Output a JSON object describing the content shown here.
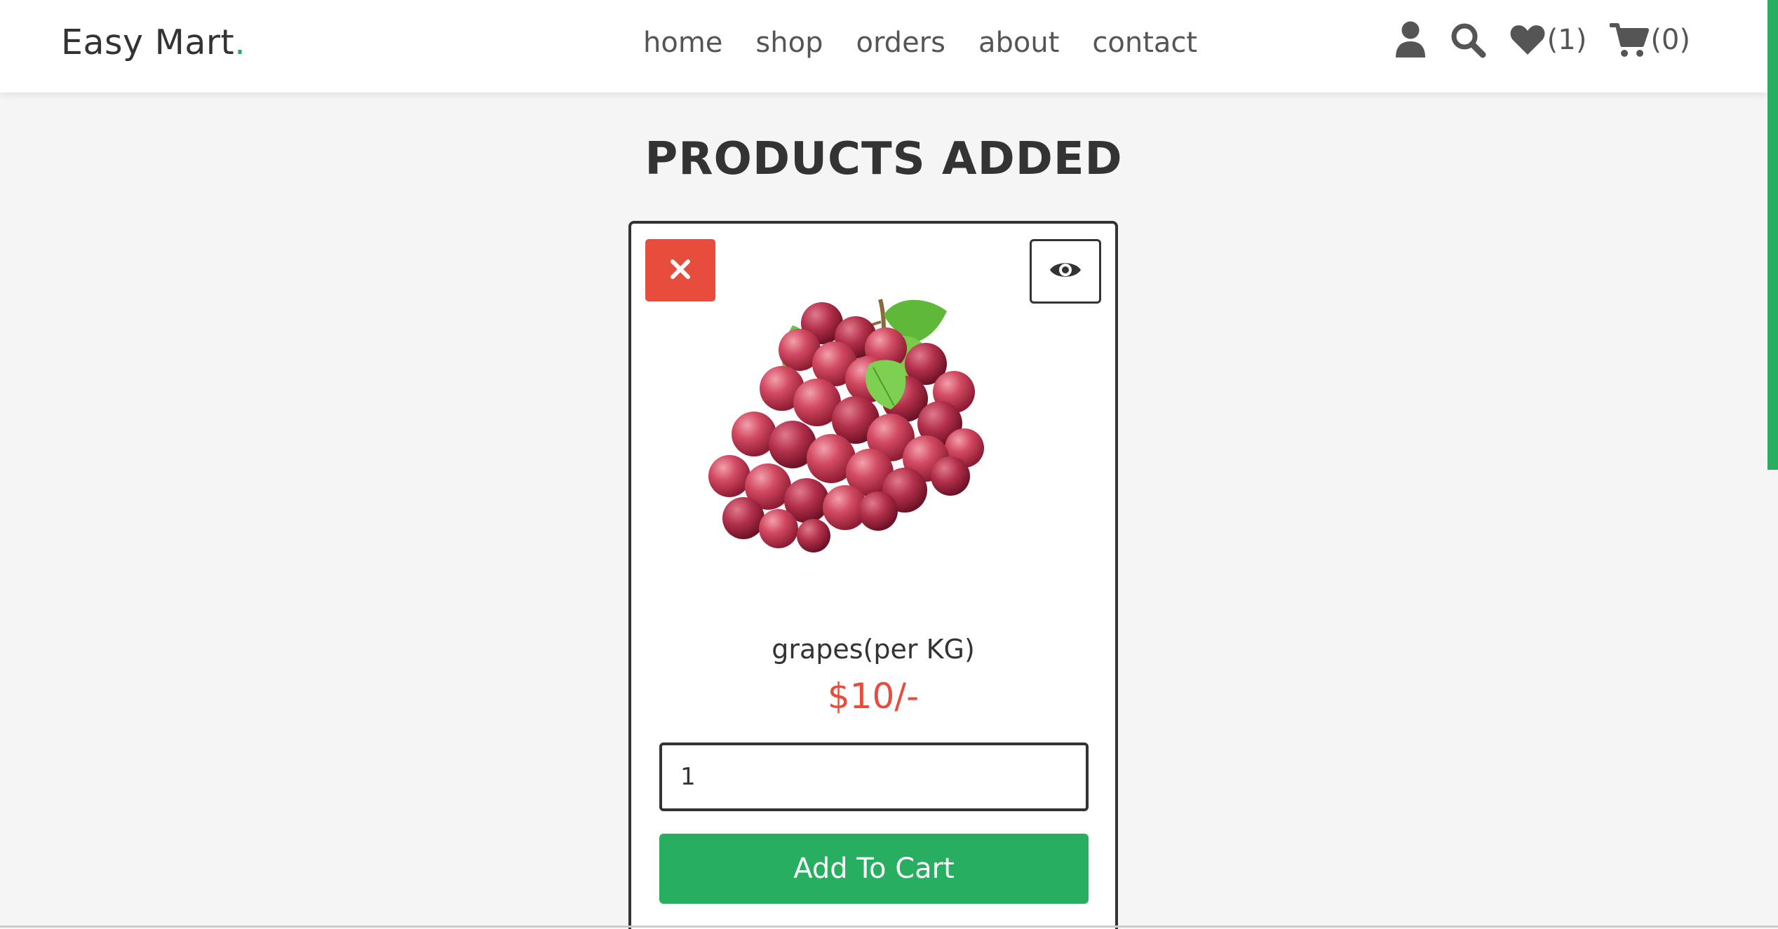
{
  "header": {
    "logo_text": "Easy Mart",
    "logo_dot": ".",
    "nav": [
      "home",
      "shop",
      "orders",
      "about",
      "contact"
    ],
    "wishlist_count": "(1)",
    "cart_count": "(0)",
    "icons": [
      "user-icon",
      "search-icon",
      "heart-icon",
      "cart-icon"
    ]
  },
  "main": {
    "title": "PRODUCTS ADDED",
    "product": {
      "name": "grapes(per KG)",
      "price": "$10/-",
      "quantity": "1",
      "add_button": "Add To Cart",
      "image": "grapes"
    }
  },
  "colors": {
    "accent": "#27ae60",
    "danger": "#e74c3c",
    "text": "#333333",
    "background": "#f5f5f5"
  }
}
